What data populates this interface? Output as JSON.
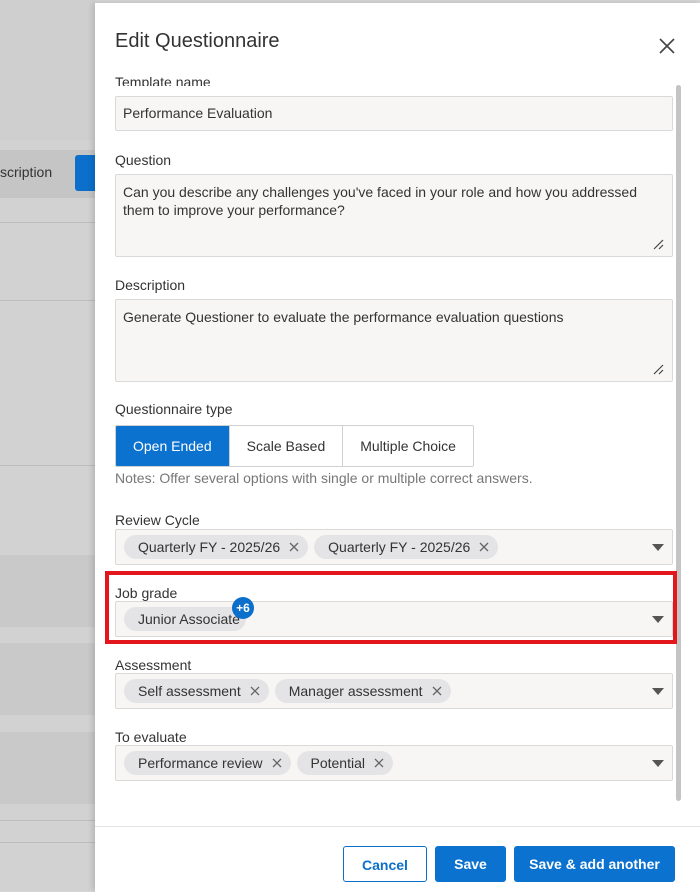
{
  "background": {
    "partial_label": "scription"
  },
  "dialog": {
    "title": "Edit Questionnaire",
    "template_name": {
      "label": "Template name",
      "value": "Performance Evaluation"
    },
    "question": {
      "label": "Question",
      "value": "Can you describe any challenges you've faced in your role and how you addressed them to improve your performance?"
    },
    "description": {
      "label": "Description",
      "value": "Generate Questioner to evaluate the performance evaluation questions"
    },
    "questionnaire_type": {
      "label": "Questionnaire type",
      "options": [
        "Open Ended",
        "Scale Based",
        "Multiple Choice"
      ],
      "selected": "Open Ended",
      "note": "Notes: Offer several options with single or multiple correct answers."
    },
    "review_cycle": {
      "label": "Review Cycle",
      "chips": [
        "Quarterly FY - 2025/26",
        "Quarterly FY - 2025/26"
      ]
    },
    "job_grade": {
      "label": "Job grade",
      "chips": [
        "Junior Associate"
      ],
      "more_badge": "+6"
    },
    "assessment": {
      "label": "Assessment",
      "chips": [
        "Self assessment",
        "Manager assessment"
      ]
    },
    "to_evaluate": {
      "label": "To evaluate",
      "chips": [
        "Performance review",
        "Potential"
      ]
    },
    "buttons": {
      "cancel": "Cancel",
      "save": "Save",
      "save_add": "Save & add another"
    }
  },
  "colors": {
    "accent": "#0b72d0",
    "highlight": "#e3161c"
  }
}
